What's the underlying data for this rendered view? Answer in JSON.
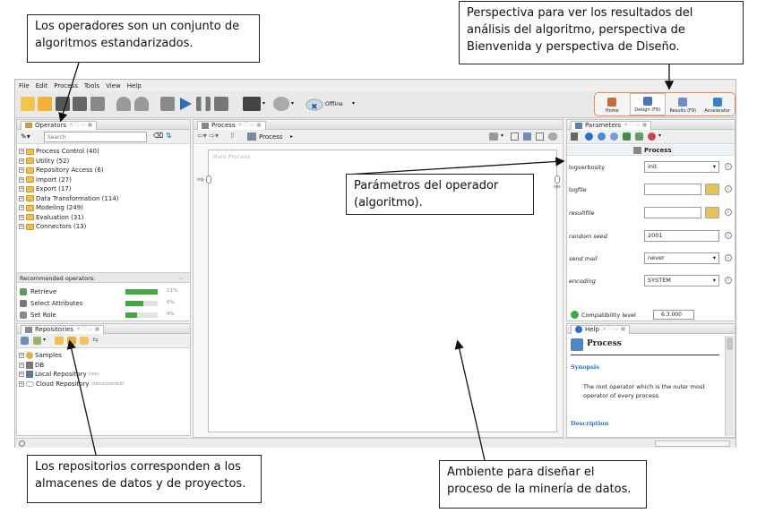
{
  "menu": [
    "File",
    "Edit",
    "Process",
    "Tools",
    "View",
    "Help"
  ],
  "toolbar": {
    "connection_status": "Offline"
  },
  "perspectives": [
    {
      "label": "Home",
      "active": false
    },
    {
      "label": "Design (F8)",
      "active": true
    },
    {
      "label": "Results (F9)",
      "active": false
    },
    {
      "label": "Accelerator",
      "active": false
    }
  ],
  "operators": {
    "title": "Operators",
    "search_placeholder": "Search",
    "groups": [
      "Process Control (40)",
      "Utility (52)",
      "Repository Access (6)",
      "Import (27)",
      "Export (17)",
      "Data Transformation (114)",
      "Modeling (249)",
      "Evaluation (31)",
      "Connectors (13)"
    ],
    "recommended_title": "Recommended operators:",
    "recommended": [
      {
        "name": "Retrieve",
        "pct": "11%",
        "value": 0.11
      },
      {
        "name": "Select Attributes",
        "pct": "6%",
        "value": 0.06
      },
      {
        "name": "Set Role",
        "pct": "4%",
        "value": 0.04
      }
    ]
  },
  "repositories": {
    "title": "Repositories",
    "items": [
      {
        "name": "Samples",
        "note": ""
      },
      {
        "name": "DB",
        "note": ""
      },
      {
        "name": "Local Repository",
        "note": "(rep)"
      },
      {
        "name": "Cloud Repository",
        "note": "(disconnected)"
      }
    ]
  },
  "process": {
    "title": "Process",
    "breadcrumb": "Process",
    "canvas_label": "Main Process",
    "port_inp": "inp",
    "port_res": "res"
  },
  "parameters": {
    "title": "Parameters",
    "operator": "Process",
    "rows": [
      {
        "label": "logverbosity",
        "value": "init",
        "type": "select"
      },
      {
        "label": "logfile",
        "value": "",
        "type": "file"
      },
      {
        "label": "resultfile",
        "value": "",
        "type": "file"
      },
      {
        "label": "random seed",
        "value": "2001",
        "type": "text"
      },
      {
        "label": "send mail",
        "value": "never",
        "type": "select"
      },
      {
        "label": "encoding",
        "value": "SYSTEM",
        "type": "select"
      }
    ],
    "compat_label": "Compatibility level",
    "compat_value": "6.3.000"
  },
  "help": {
    "title": "Help",
    "heading": "Process",
    "synopsis_label": "Synopsis",
    "synopsis": "The root operator which is the outer most operator of every process.",
    "description_label": "Description"
  },
  "callouts": {
    "operators": "Los operadores son un conjunto de algoritmos estandarizados.",
    "perspectives": "Perspectiva para ver los resultados del análisis del algoritmo, perspectiva de Bienvenida y perspectiva de Diseño.",
    "parameters": "Parámetros del operador (algoritmo).",
    "repositories": "Los repositorios corresponden a los almacenes de datos y de proyectos.",
    "ambiente": "Ambiente para diseñar el proceso de la minería de datos."
  },
  "colors": {
    "accent": "#2a6fc4",
    "perspective_border": "#e88a5a",
    "bar": "#3faa3f"
  }
}
